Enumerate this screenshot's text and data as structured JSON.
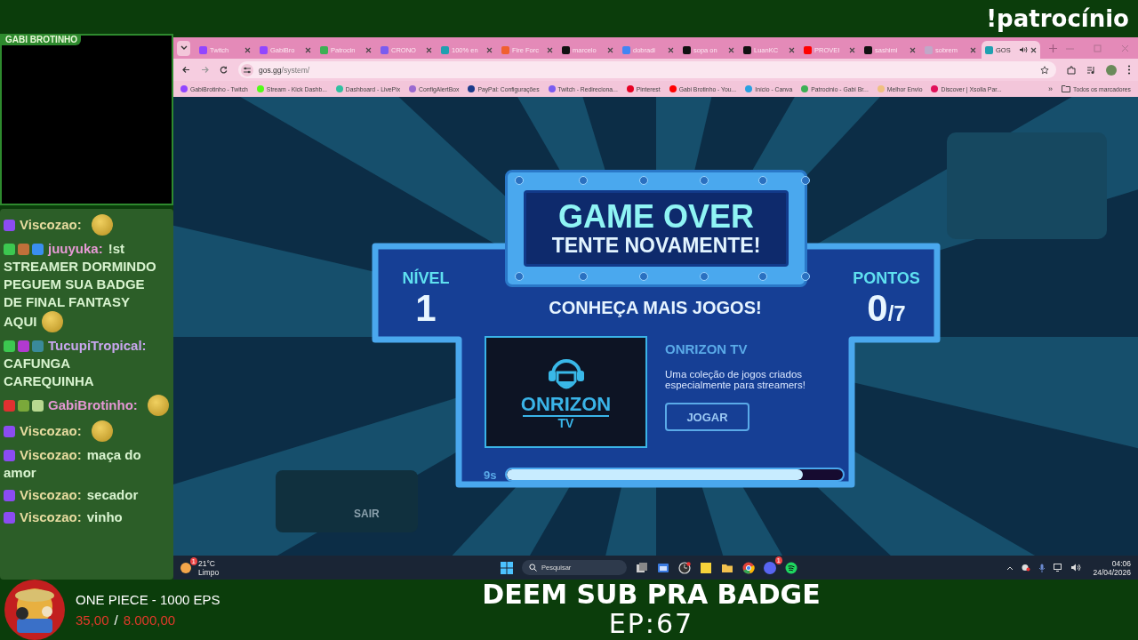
{
  "overlay": {
    "command": "!patrocínio",
    "webcam_label": "GABI BROTINHO"
  },
  "chat": [
    {
      "user": "Viscozao:",
      "color": "#e8dca0",
      "badges": [
        {
          "color": "#8b4cf2"
        }
      ],
      "emote": true
    },
    {
      "user": "juuyuka:",
      "color": "#e79ad6",
      "badges": [
        {
          "color": "#3cc850"
        },
        {
          "color": "#c0703a"
        },
        {
          "color": "#3a8ef0"
        }
      ],
      "text_lines": [
        "!st",
        "STREAMER DORMINDO",
        "PEGUEM SUA BADGE",
        "DE FINAL FANTASY",
        "AQUI"
      ],
      "emote": true
    },
    {
      "user": "TucupiTropical:",
      "color": "#c9a6ee",
      "badges": [
        {
          "color": "#3cc850"
        },
        {
          "color": "#b23ad0"
        },
        {
          "color": "#3a8a9a"
        }
      ],
      "text_lines": [
        "CAFUNGA",
        "CAREQUINHA"
      ],
      "emote": false
    },
    {
      "user": "GabiBrotinho:",
      "color": "#e597d4",
      "badges": [
        {
          "color": "#e03030"
        },
        {
          "color": "#7aa83a"
        },
        {
          "color": "#b8d890"
        }
      ],
      "emote": true
    },
    {
      "user": "Viscozao:",
      "color": "#e8dca0",
      "badges": [
        {
          "color": "#8b4cf2"
        }
      ],
      "emote": true
    },
    {
      "user": "Viscozao:",
      "color": "#e8dca0",
      "badges": [
        {
          "color": "#8b4cf2"
        }
      ],
      "text_lines": [
        "maça do",
        "amor"
      ],
      "emote": false
    },
    {
      "user": "Viscozao:",
      "color": "#e8dca0",
      "badges": [
        {
          "color": "#8b4cf2"
        }
      ],
      "text_lines": [
        "secador"
      ],
      "emote": false
    },
    {
      "user": "Viscozao:",
      "color": "#e8dca0",
      "badges": [
        {
          "color": "#8b4cf2"
        }
      ],
      "text_lines": [
        "vinho"
      ],
      "emote": false
    }
  ],
  "browser": {
    "tabs": [
      {
        "title": "Twitch",
        "color": "#9146ff",
        "selected": false,
        "playing_audio": false
      },
      {
        "title": "GabiBro",
        "color": "#9146ff",
        "selected": false,
        "playing_audio": false
      },
      {
        "title": "Patrocin",
        "color": "#3cb054",
        "selected": false,
        "playing_audio": false
      },
      {
        "title": "CRONO",
        "color": "#7a5cf0",
        "selected": false,
        "playing_audio": false
      },
      {
        "title": "100% en",
        "color": "#1fa0b0",
        "selected": false,
        "playing_audio": false
      },
      {
        "title": "Fire Forc",
        "color": "#f06030",
        "selected": false,
        "playing_audio": false
      },
      {
        "title": "marcelo",
        "color": "#111111",
        "selected": false,
        "playing_audio": false
      },
      {
        "title": "dobradi",
        "color": "#4285f4",
        "selected": false,
        "playing_audio": false
      },
      {
        "title": "sopa on",
        "color": "#111111",
        "selected": false,
        "playing_audio": false
      },
      {
        "title": "LuanKC",
        "color": "#111111",
        "selected": false,
        "playing_audio": false
      },
      {
        "title": "PROVEI",
        "color": "#ff0000",
        "selected": false,
        "playing_audio": false
      },
      {
        "title": "sashimi",
        "color": "#111111",
        "selected": false,
        "playing_audio": false
      },
      {
        "title": "sobrem",
        "color": "#c0a8c8",
        "selected": false,
        "playing_audio": false
      },
      {
        "title": "GOS",
        "color": "#1fa0b0",
        "selected": true,
        "playing_audio": true
      }
    ],
    "url_domain": "gos.gg",
    "url_path": "/system/",
    "bookmarks": [
      {
        "label": "GabiBrotinho - Twitch",
        "color": "#9146ff"
      },
      {
        "label": "Stream - Kick Dashb...",
        "color": "#53fc18"
      },
      {
        "label": "Dashboard - LivePix",
        "color": "#30c0a0"
      },
      {
        "label": "ConfigAlertBox",
        "color": "#9a6ad0"
      },
      {
        "label": "PayPal: Configurações",
        "color": "#1a3a8a"
      },
      {
        "label": "Twitch - Redireciona...",
        "color": "#7a5cf0"
      },
      {
        "label": "Pinterest",
        "color": "#e60023"
      },
      {
        "label": "Gabi Brotinho - You...",
        "color": "#ff0000"
      },
      {
        "label": "Início - Canva",
        "color": "#2aa0e0"
      },
      {
        "label": "Patrocinio - Gabi Br...",
        "color": "#3cb054"
      },
      {
        "label": "Melhor Envio",
        "color": "#f0c080"
      },
      {
        "label": "Discover | Xsolla Par...",
        "color": "#e0105a"
      }
    ],
    "bookmarks_more": "»",
    "all_bookmarks": "Todos os marcadores"
  },
  "game": {
    "background_label": "SAIR",
    "title": "GAME OVER",
    "subtitle": "TENTE NOVAMENTE!",
    "level_label": "NÍVEL",
    "level_value": "1",
    "points_label": "PONTOS",
    "points_value": "0",
    "points_total": "/7",
    "promo_heading": "CONHEÇA MAIS JOGOS!",
    "promo": {
      "logo_word": "ONRIZON",
      "logo_sub": "TV",
      "name": "ONRIZON TV",
      "description": "Uma coleção de jogos criados especialmente para streamers!",
      "button": "JOGAR"
    },
    "timer": "9s",
    "timer_bar": {
      "level": 0.88
    }
  },
  "taskbar": {
    "weather_badge": "1",
    "temperature": "21°C",
    "weather": "Limpo",
    "search_placeholder": "Pesquisar",
    "discord_badge": "1",
    "time": "04:06",
    "date": "24/04/2026"
  },
  "sub_goal": {
    "title": "ONE PIECE - 1000 EPS",
    "current": "35,00",
    "separator": "/",
    "target": "8.000,00"
  },
  "banner": {
    "line1": "DEEM SUB PRA BADGE",
    "line2": "EP:67"
  }
}
